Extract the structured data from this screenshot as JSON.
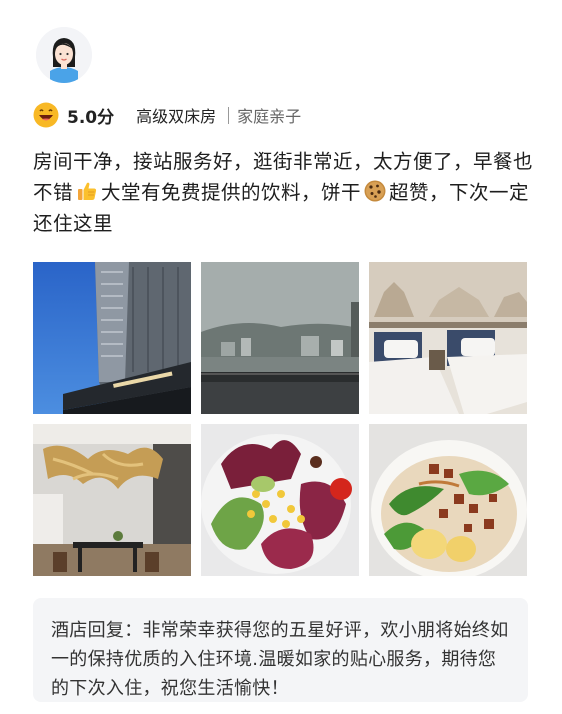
{
  "review": {
    "score": "5.0分",
    "room_type": "高级双床房",
    "tag": "家庭亲子",
    "text_part1": "房间干净，接站服务好，逛街非常近，太方便了，早餐也不错",
    "text_part2": "大堂有免费提供的饮料，饼干",
    "text_part3": "超赞，下次一定还住这里",
    "photos": [
      {
        "icon": "hotel-exterior-photo"
      },
      {
        "icon": "city-view-photo"
      },
      {
        "icon": "twin-bedroom-photo"
      },
      {
        "icon": "lobby-photo"
      },
      {
        "icon": "salad-photo"
      },
      {
        "icon": "noodles-photo"
      }
    ],
    "emojis": [
      "thumbs-up",
      "cookie"
    ]
  },
  "reply": {
    "text": "酒店回复：非常荣幸获得您的五星好评，欢小朋将始终如一的保持优质的入住环境.温暖如家的贴心服务，期待您的下次入住，祝您生活愉快！"
  },
  "colors": {
    "reply_bg": "#f4f5f7",
    "text": "#1e1e1e",
    "tag": "#666666"
  }
}
